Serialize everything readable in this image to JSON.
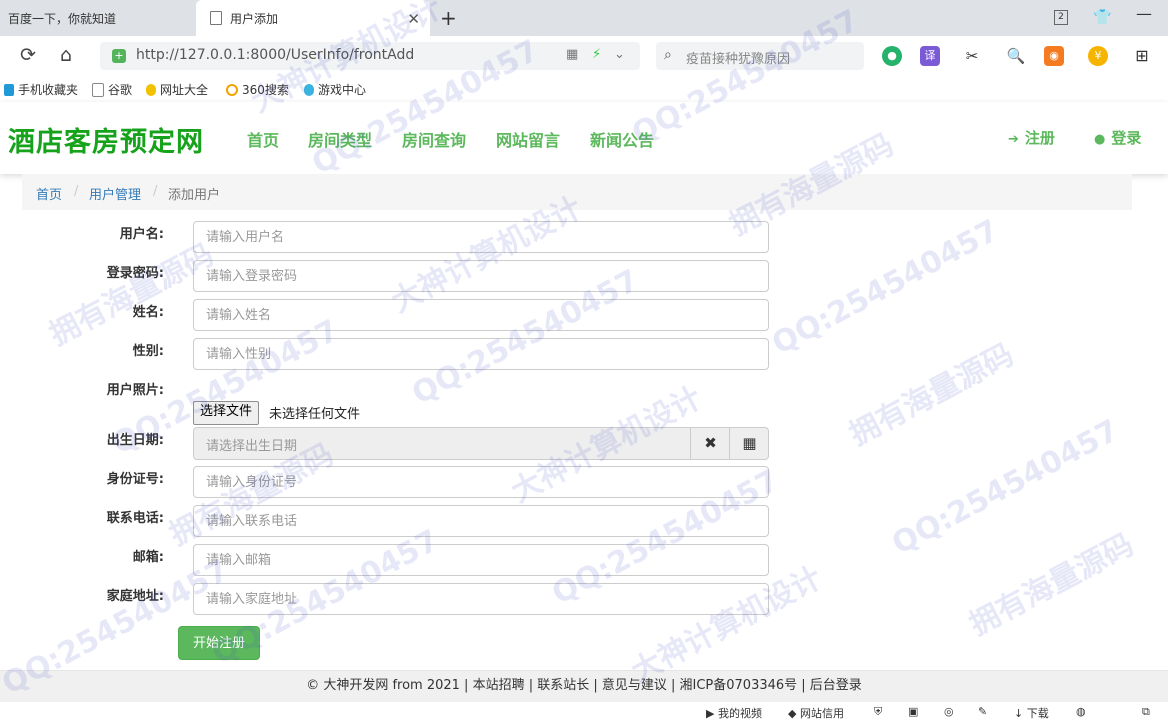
{
  "browser": {
    "tabs": [
      {
        "title": "百度一下，你就知道",
        "active": false
      },
      {
        "title": "用户添加",
        "active": true
      }
    ],
    "new_tab": "+",
    "tab_count": "2",
    "minimize": "—",
    "url": "http://127.0.0.1:8000/UserInfo/frontAdd",
    "search_placeholder": "疫苗接种犹豫原因",
    "bookmarks": [
      "手机收藏夹",
      "谷歌",
      "网址大全",
      "360搜索",
      "游戏中心"
    ],
    "ext_translate": "译",
    "ext_yen": "¥"
  },
  "site": {
    "logo": "酒店客房预定网",
    "nav": [
      "首页",
      "房间类型",
      "房间查询",
      "网站留言",
      "新闻公告"
    ],
    "register": "注册",
    "login": "登录",
    "accent": "#5cb85c",
    "logo_color": "#16a21b"
  },
  "breadcrumb": {
    "home": "首页",
    "sep": "/",
    "section": "用户管理",
    "current": "添加用户"
  },
  "form": {
    "username": {
      "label": "用户名:",
      "placeholder": "请输入用户名"
    },
    "password": {
      "label": "登录密码:",
      "placeholder": "请输入登录密码"
    },
    "name": {
      "label": "姓名:",
      "placeholder": "请输入姓名"
    },
    "gender": {
      "label": "性别:",
      "placeholder": "请输入性别"
    },
    "photo": {
      "label": "用户照片:",
      "button": "选择文件",
      "status": "未选择任何文件"
    },
    "birthday": {
      "label": "出生日期:",
      "placeholder": "请选择出生日期"
    },
    "id_card": {
      "label": "身份证号:",
      "placeholder": "请输入身份证号"
    },
    "phone": {
      "label": "联系电话:",
      "placeholder": "请输入联系电话"
    },
    "email": {
      "label": "邮箱:",
      "placeholder": "请输入邮箱"
    },
    "address": {
      "label": "家庭地址:",
      "placeholder": "请输入家庭地址"
    },
    "submit": "开始注册"
  },
  "footer": {
    "text": "© 大神开发网 from 2021 | 本站招聘 | 联系站长 | 意见与建议 | 湘ICP备0703346号 | 后台登录"
  },
  "statusbar": {
    "video": "我的视频",
    "credit": "网站信用",
    "download": "下载"
  },
  "watermarks": [
    "QQ:254540457",
    "大神计算机设计",
    "拥有海量源码"
  ]
}
